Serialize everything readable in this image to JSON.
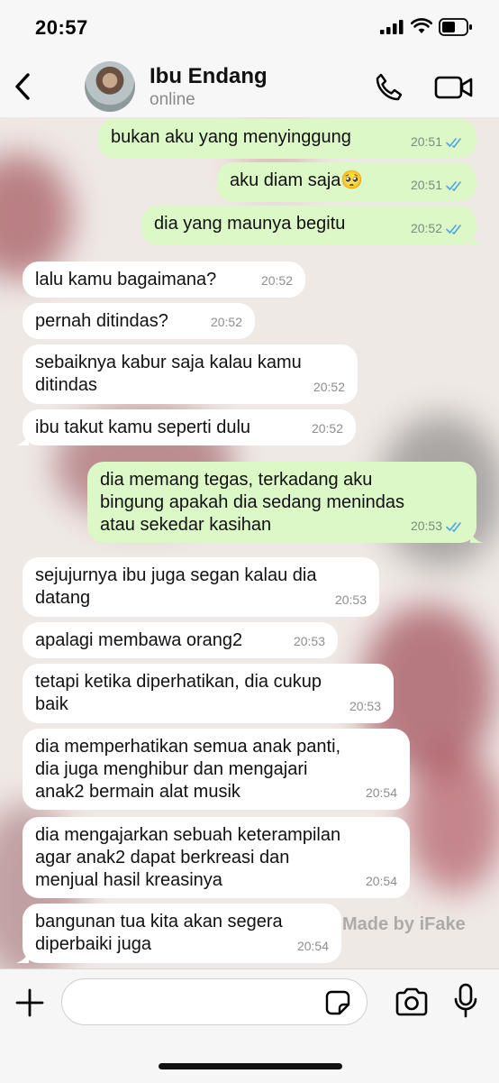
{
  "status": {
    "time": "20:57"
  },
  "header": {
    "name": "Ibu Endang",
    "status": "online"
  },
  "watermark": "Made by iFake",
  "colors": {
    "outgoing": "#dcf8c6",
    "incoming": "#ffffff",
    "read_tick": "#4fa3e0"
  },
  "messages": [
    {
      "dir": "out",
      "text": "bukan aku yang menyinggung",
      "time": "20:51",
      "ticks": "read"
    },
    {
      "dir": "out",
      "text": "aku diam saja🥺",
      "time": "20:51",
      "ticks": "read"
    },
    {
      "dir": "out",
      "text": "dia yang maunya begitu",
      "time": "20:52",
      "ticks": "read"
    },
    {
      "dir": "in",
      "text": "lalu kamu bagaimana?",
      "time": "20:52"
    },
    {
      "dir": "in",
      "text": "pernah ditindas?",
      "time": "20:52"
    },
    {
      "dir": "in",
      "text": "sebaiknya kabur saja kalau kamu\nditindas",
      "time": "20:52"
    },
    {
      "dir": "in",
      "text": "ibu takut kamu seperti dulu",
      "time": "20:52"
    },
    {
      "dir": "out",
      "text": "dia memang tegas, terkadang aku\nbingung apakah dia sedang menindas\natau sekedar kasihan",
      "time": "20:53",
      "ticks": "read"
    },
    {
      "dir": "in",
      "text": "sejujurnya ibu juga segan kalau dia\ndatang",
      "time": "20:53"
    },
    {
      "dir": "in",
      "text": "apalagi membawa orang2",
      "time": "20:53"
    },
    {
      "dir": "in",
      "text": "tetapi ketika diperhatikan, dia cukup\nbaik",
      "time": "20:53"
    },
    {
      "dir": "in",
      "text": "dia memperhatikan semua anak panti,\ndia juga menghibur dan mengajari\nanak2 bermain alat musik",
      "time": "20:54"
    },
    {
      "dir": "in",
      "text": "dia mengajarkan sebuah keterampilan\nagar anak2 dapat berkreasi dan\nmenjual hasil kreasinya",
      "time": "20:54"
    },
    {
      "dir": "in",
      "text": "bangunan tua kita akan segera\ndiperbaiki juga",
      "time": "20:54"
    }
  ]
}
